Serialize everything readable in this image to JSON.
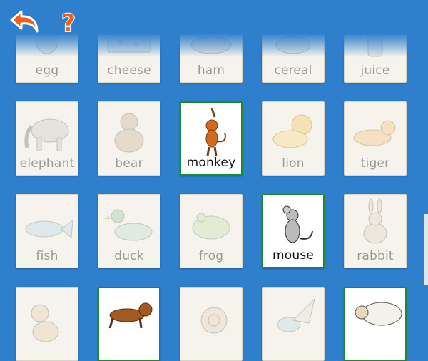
{
  "toolbar": {
    "back_icon": "undo-arrow-icon",
    "help_icon": "question-mark-icon",
    "help_glyph": "?"
  },
  "colors": {
    "background": "#2e7fcc",
    "accent": "#f0601a",
    "selected_border": "#1d8a2d"
  },
  "rows": [
    {
      "cards": [
        {
          "label": "egg",
          "icon": "egg-icon",
          "selected": false
        },
        {
          "label": "cheese",
          "icon": "cheese-icon",
          "selected": false
        },
        {
          "label": "ham",
          "icon": "ham-icon",
          "selected": false
        },
        {
          "label": "cereal",
          "icon": "cereal-icon",
          "selected": false
        },
        {
          "label": "juice",
          "icon": "juice-icon",
          "selected": false
        }
      ]
    },
    {
      "cards": [
        {
          "label": "elephant",
          "icon": "elephant-icon",
          "selected": false
        },
        {
          "label": "bear",
          "icon": "bear-icon",
          "selected": false
        },
        {
          "label": "monkey",
          "icon": "monkey-icon",
          "selected": true
        },
        {
          "label": "lion",
          "icon": "lion-icon",
          "selected": false
        },
        {
          "label": "tiger",
          "icon": "tiger-icon",
          "selected": false
        }
      ]
    },
    {
      "cards": [
        {
          "label": "fish",
          "icon": "fish-icon",
          "selected": false
        },
        {
          "label": "duck",
          "icon": "duck-icon",
          "selected": false
        },
        {
          "label": "frog",
          "icon": "frog-icon",
          "selected": false
        },
        {
          "label": "mouse",
          "icon": "mouse-icon",
          "selected": true
        },
        {
          "label": "rabbit",
          "icon": "rabbit-icon",
          "selected": false
        }
      ]
    },
    {
      "cards": [
        {
          "label": "",
          "icon": "cat-icon",
          "selected": false
        },
        {
          "label": "",
          "icon": "dog-icon",
          "selected": true
        },
        {
          "label": "",
          "icon": "snail-icon",
          "selected": false
        },
        {
          "label": "",
          "icon": "bird-icon",
          "selected": false
        },
        {
          "label": "",
          "icon": "sheep-icon",
          "selected": true
        }
      ]
    }
  ]
}
